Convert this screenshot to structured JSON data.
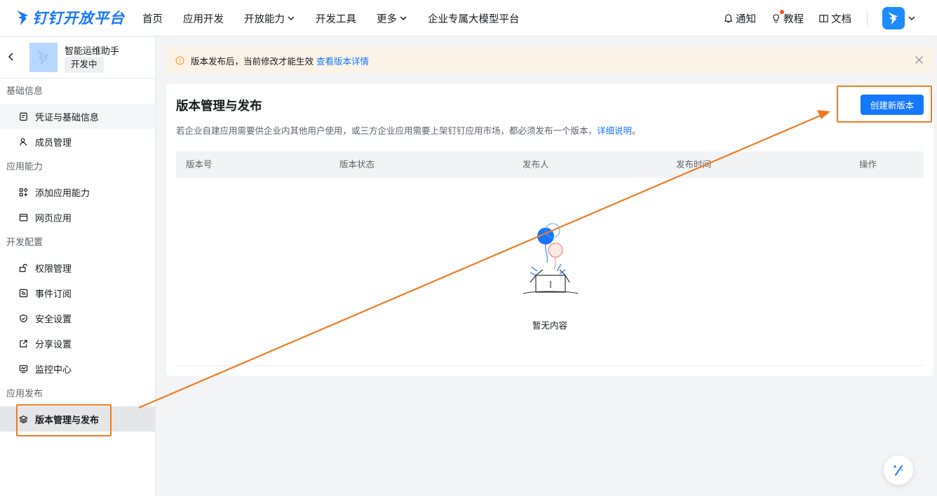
{
  "brand": {
    "name": "钉钉开放平台"
  },
  "nav": {
    "items": [
      {
        "label": "首页",
        "dropdown": false
      },
      {
        "label": "应用开发",
        "dropdown": false
      },
      {
        "label": "开放能力",
        "dropdown": true
      },
      {
        "label": "开发工具",
        "dropdown": false
      },
      {
        "label": "更多",
        "dropdown": true
      },
      {
        "label": "企业专属大模型平台",
        "dropdown": false
      }
    ],
    "tools": {
      "notify": "通知",
      "tutorial": "教程",
      "docs": "文档"
    }
  },
  "app": {
    "name": "智能运维助手",
    "status": "开发中"
  },
  "sidebar": {
    "groups": [
      {
        "title": "基础信息",
        "items": [
          {
            "label": "凭证与基础信息",
            "icon": "credential-icon"
          },
          {
            "label": "成员管理",
            "icon": "user-icon"
          }
        ]
      },
      {
        "title": "应用能力",
        "items": [
          {
            "label": "添加应用能力",
            "icon": "add-capability-icon"
          },
          {
            "label": "网页应用",
            "icon": "browser-icon"
          }
        ]
      },
      {
        "title": "开发配置",
        "items": [
          {
            "label": "权限管理",
            "icon": "lock-icon"
          },
          {
            "label": "事件订阅",
            "icon": "subscription-icon"
          },
          {
            "label": "安全设置",
            "icon": "shield-icon"
          },
          {
            "label": "分享设置",
            "icon": "share-icon"
          },
          {
            "label": "监控中心",
            "icon": "monitor-icon"
          }
        ]
      },
      {
        "title": "应用发布",
        "items": [
          {
            "label": "版本管理与发布",
            "icon": "layers-icon"
          }
        ]
      }
    ]
  },
  "notice": {
    "text": "版本发布后，当前修改才能生效",
    "link": "查看版本详情"
  },
  "main": {
    "title": "版本管理与发布",
    "desc": "若企业自建应用需要供企业内其他用户使用，或三方企业应用需要上架钉钉应用市场，都必须发布一个版本，",
    "desc_link": "详细说明",
    "desc_end": "。",
    "create_button": "创建新版本",
    "columns": [
      "版本号",
      "版本状态",
      "发布人",
      "发布时间",
      "操作"
    ],
    "empty_text": "暂无内容"
  },
  "colors": {
    "accent": "#1677ff",
    "annotation": "#f07a21",
    "notice_bg": "#fcf3e8"
  }
}
